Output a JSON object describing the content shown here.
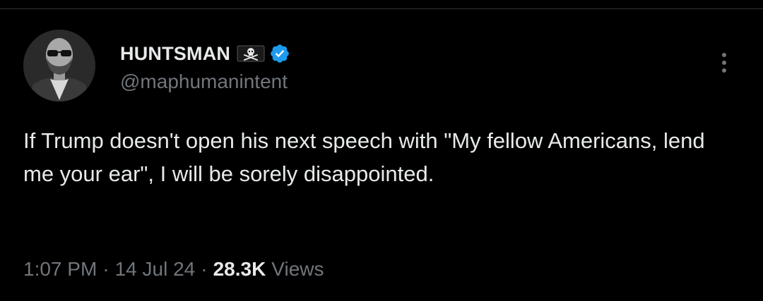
{
  "tweet": {
    "author": {
      "display_name": "HUNTSMAN",
      "handle": "@maphumanintent",
      "flag_icon": "pirate-flag-icon",
      "verified_icon": "verified-badge-icon",
      "verified_color": "#1d9bf0"
    },
    "text": "If Trump doesn't open his next speech with \"My fellow Americans, lend me your ear\", I will be sorely disappointed.",
    "time": "1:07 PM",
    "separator": "·",
    "date": "14 Jul 24",
    "views_count": "28.3K",
    "views_label": "Views",
    "more_icon": "more-vertical-icon"
  },
  "colors": {
    "background": "#000000",
    "primary_text": "#e7e9ea",
    "secondary_text": "#71767b"
  }
}
